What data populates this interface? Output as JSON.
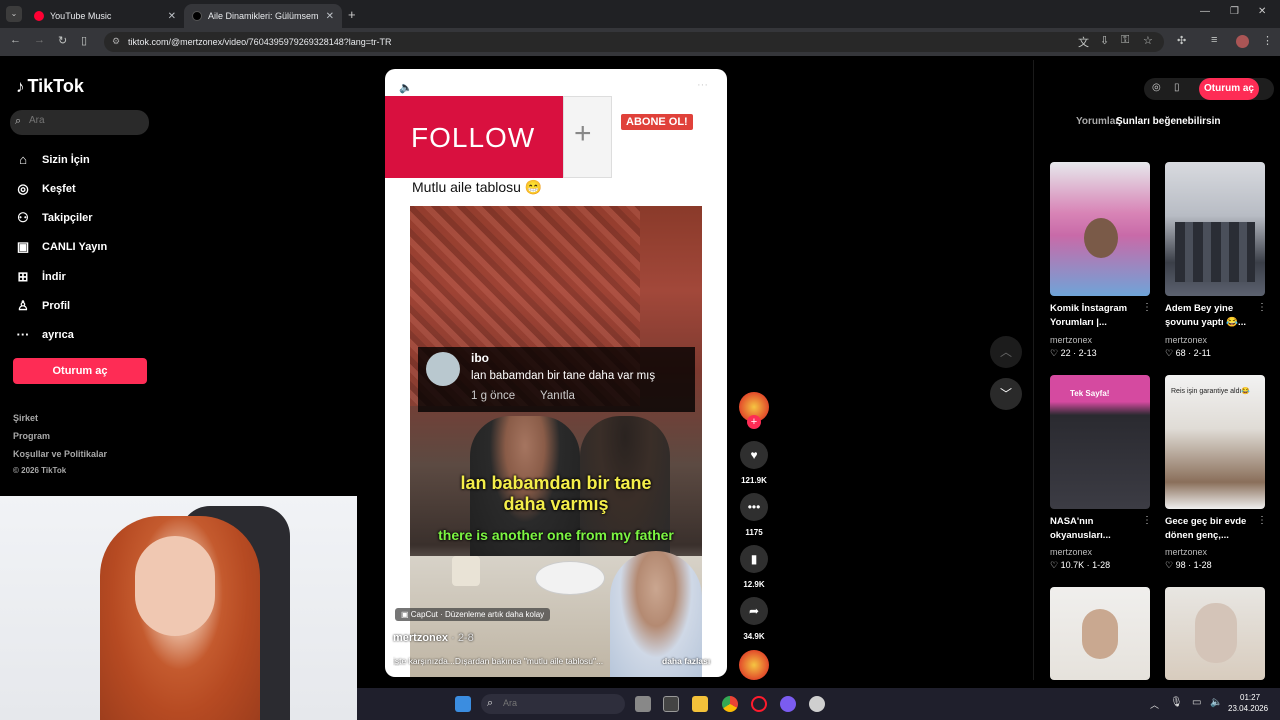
{
  "browser": {
    "tabs": [
      {
        "title": "YouTube Music",
        "active": false
      },
      {
        "title": "Aile Dinamikleri: Gülümsemenin...",
        "active": true
      }
    ],
    "url": "tiktok.com/@mertzonex/video/7604395979269328148?lang=tr-TR"
  },
  "sidebar": {
    "logo": "TikTok",
    "search_placeholder": "Ara",
    "items": [
      {
        "label": "Sizin İçin",
        "icon": "home-icon"
      },
      {
        "label": "Keşfet",
        "icon": "compass-icon"
      },
      {
        "label": "Takipçiler",
        "icon": "user-icon"
      },
      {
        "label": "CANLI Yayın",
        "icon": "live-icon"
      },
      {
        "label": "İndir",
        "icon": "download-icon"
      },
      {
        "label": "Profil",
        "icon": "profile-icon"
      },
      {
        "label": "ayrıca",
        "icon": "more-icon"
      }
    ],
    "login_button": "Oturum aç",
    "footer_links": [
      "Şirket",
      "Program",
      "Koşullar ve Politikalar"
    ],
    "copyright": "© 2026 TikTok"
  },
  "video": {
    "follow_banner": "FOLLOW",
    "plus": "+",
    "subscribe_badge": "ABONE OL!",
    "caption_title": "Mutlu aile tablosu 😁",
    "comment": {
      "user": "ibo",
      "text": "lan babamdan bir tane daha var mış",
      "time": "1 g önce",
      "reply": "Yanıtla"
    },
    "subtitle_tr": "lan babamdan bir tane daha varmış",
    "subtitle_en": "there is another one from my father",
    "capcut_label": "CapCut · Düzenleme artık daha kolay",
    "author": "mertzonex",
    "date": "2-8",
    "description": "işte karşınızda...Dışardan bakınca \"mutlu aile tablosu\"...",
    "more": "daha fazlası"
  },
  "actions": {
    "likes": "121.9K",
    "comments": "1175",
    "saves": "12.9K",
    "shares": "34.9K"
  },
  "right_panel": {
    "login_button": "Oturum aç",
    "tabs": [
      "Yorumlar",
      "Şunları beğenebilirsin"
    ],
    "cards": [
      {
        "title": "Komik İnstagram Yorumları |...",
        "author": "mertzonex",
        "likes": "22",
        "date": "2-13",
        "color1": "#c86aa8",
        "color2": "#6fa4d8"
      },
      {
        "title": "Adem Bey yine şovunu yaptı 😂...",
        "author": "mertzonex",
        "likes": "68",
        "date": "2-11",
        "color1": "#c8ccd2",
        "color2": "#3b3f48"
      },
      {
        "title": "NASA'nın okyanusları...",
        "author": "mertzonex",
        "likes": "10.7K",
        "date": "1-28",
        "color1": "#d54aa0",
        "color2": "#2a2a30"
      },
      {
        "title": "Gece geç bir evde dönen genç,...",
        "author": "mertzonex",
        "likes": "98",
        "date": "1-28",
        "color1": "#f2f2f2",
        "color2": "#8a6f5a"
      },
      {
        "title": "",
        "author": "",
        "likes": "",
        "date": "",
        "color1": "#f0efed",
        "color2": "#c9a890"
      },
      {
        "title": "",
        "author": "",
        "likes": "",
        "date": "",
        "color1": "#e8e6e2",
        "color2": "#b88a70"
      }
    ],
    "card5_label": "Tek Sayfa!",
    "card6_label": "Reis işin garantiye aldı😂"
  },
  "taskbar": {
    "search_placeholder": "Ara",
    "time": "01:27",
    "date": "23.04.2026"
  }
}
